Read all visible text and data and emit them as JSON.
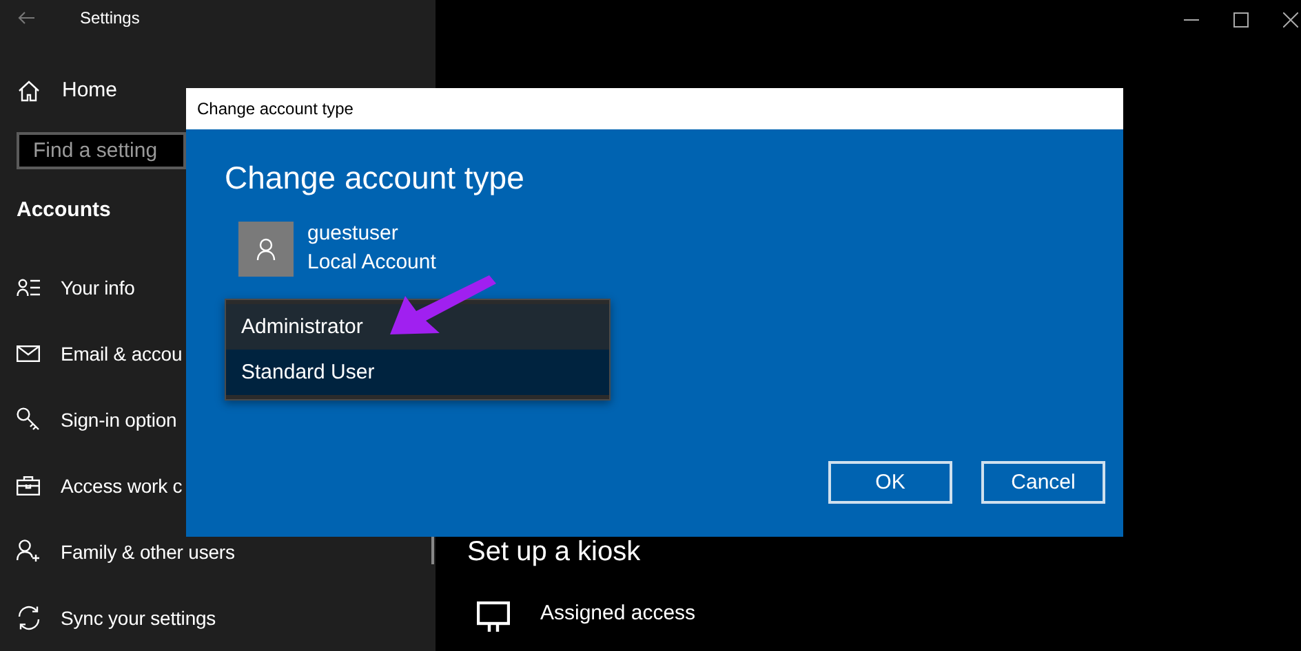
{
  "window": {
    "title": "Settings"
  },
  "sidebar": {
    "home": "Home",
    "search": {
      "placeholder": "Find a setting"
    },
    "section": "Accounts",
    "items": [
      {
        "label": "Your info",
        "kind": "info"
      },
      {
        "label": "Email & accou",
        "kind": "email"
      },
      {
        "label": "Sign-in option",
        "kind": "key"
      },
      {
        "label": "Access work c",
        "kind": "briefcase"
      },
      {
        "label": "Family & other users",
        "kind": "family"
      },
      {
        "label": "Sync your settings",
        "kind": "sync"
      }
    ]
  },
  "content": {
    "section_title": "Set up a kiosk",
    "items": [
      {
        "label": "Assigned access"
      }
    ]
  },
  "dialog": {
    "title": "Change account type",
    "heading": "Change account type",
    "account": {
      "name": "guestuser",
      "type": "Local Account"
    },
    "dropdown": {
      "options": [
        {
          "label": "Administrator",
          "selected": false
        },
        {
          "label": "Standard User",
          "selected": true
        }
      ]
    },
    "buttons": [
      "OK",
      "Cancel"
    ]
  }
}
